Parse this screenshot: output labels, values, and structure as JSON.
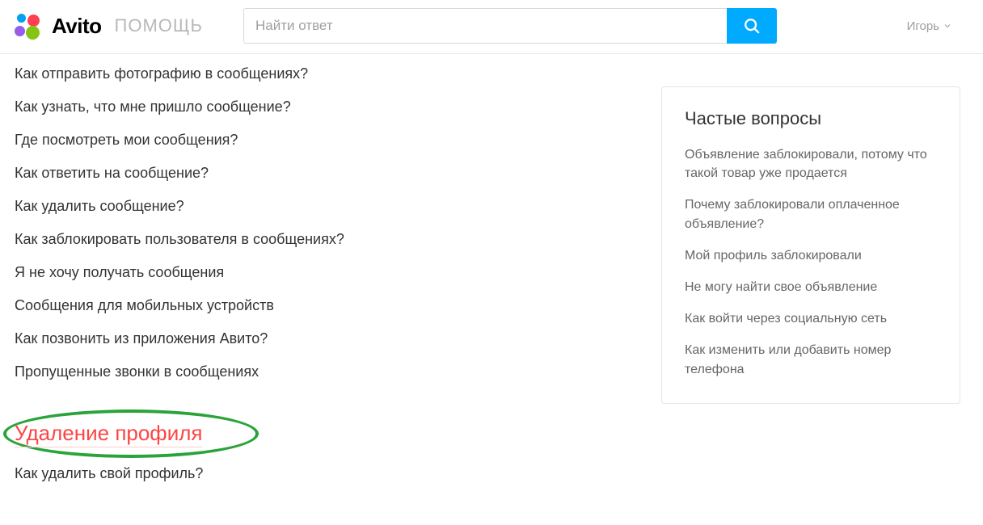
{
  "header": {
    "brand": "Avito",
    "help_label": "ПОМОЩЬ",
    "search_placeholder": "Найти ответ",
    "user_name": "Игорь"
  },
  "main": {
    "faq_links": [
      "Как отправить фотографию в сообщениях?",
      "Как узнать, что мне пришло сообщение?",
      "Где посмотреть мои сообщения?",
      "Как ответить на сообщение?",
      "Как удалить сообщение?",
      "Как заблокировать пользователя в сообщениях?",
      "Я не хочу получать сообщения",
      "Сообщения для мобильных устройств",
      "Как позвонить из приложения Авито?",
      "Пропущенные звонки в сообщениях"
    ],
    "highlighted_section_title": "Удаление профиля",
    "highlighted_section_links": [
      "Как удалить свой профиль?"
    ]
  },
  "sidebar": {
    "title": "Частые вопросы",
    "links": [
      "Объявление заблокировали, потому что такой товар уже продается",
      "Почему заблокировали оплаченное объявление?",
      "Мой профиль заблокировали",
      "Не могу найти свое объявление",
      "Как войти через социальную сеть",
      "Как изменить или добавить номер телефона"
    ]
  }
}
